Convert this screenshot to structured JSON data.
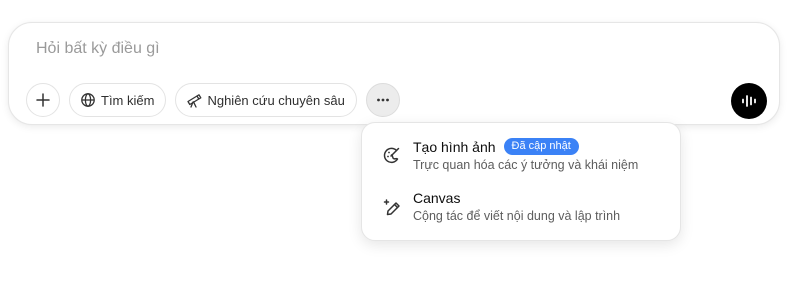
{
  "composer": {
    "placeholder": "Hỏi bất kỳ điều gì",
    "buttons": {
      "add": {
        "icon": "plus-icon"
      },
      "search": {
        "label": "Tìm kiếm",
        "icon": "globe-icon"
      },
      "research": {
        "label": "Nghiên cứu chuyên sâu",
        "icon": "telescope-icon"
      },
      "more": {
        "icon": "ellipsis-icon"
      },
      "voice": {
        "icon": "waveform-icon"
      }
    }
  },
  "menu": {
    "items": [
      {
        "title": "Tạo hình ảnh",
        "badge": "Đã cập nhật",
        "subtitle": "Trực quan hóa các ý tưởng và khái niệm",
        "icon": "palette-icon"
      },
      {
        "title": "Canvas",
        "subtitle": "Cộng tác để viết nội dung và lập trình",
        "icon": "pencil-sparkle-icon"
      }
    ]
  },
  "colors": {
    "badge": "#3b82f6",
    "voice_button": "#000000",
    "placeholder": "#9a9a9a"
  }
}
